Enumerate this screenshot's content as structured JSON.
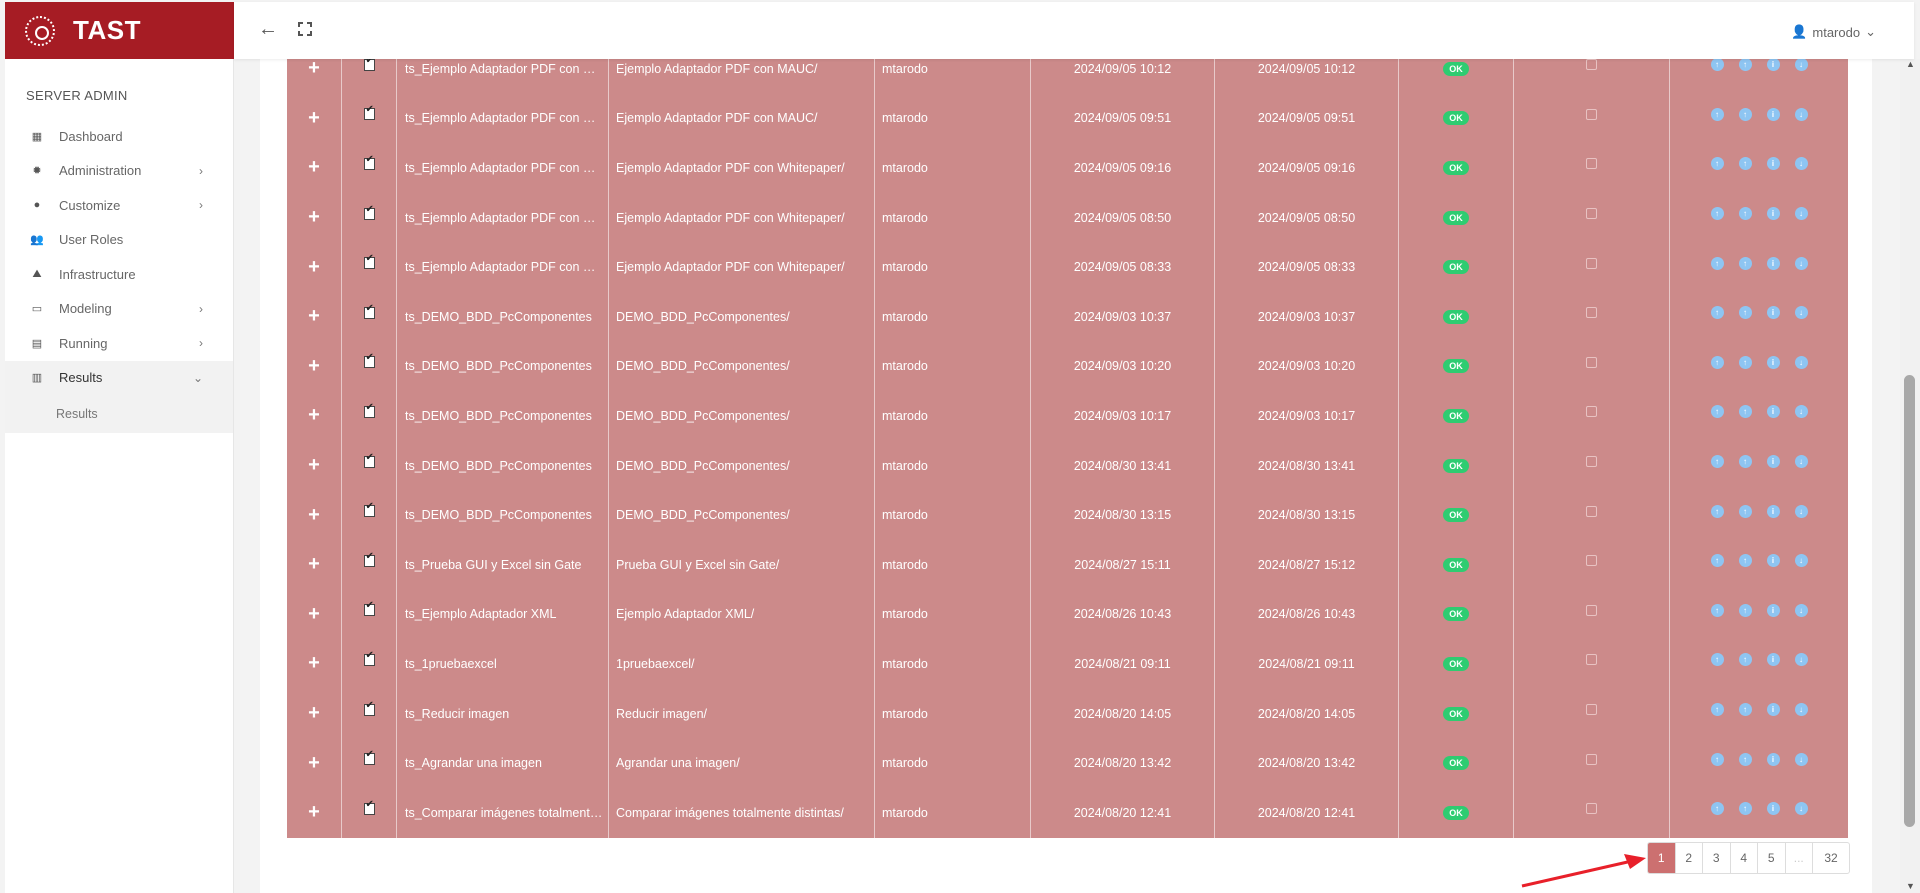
{
  "brand": {
    "name": "TAST"
  },
  "topbar": {
    "user": "mtarodo"
  },
  "sidebar": {
    "section": "SERVER ADMIN",
    "items": [
      {
        "label": "Dashboard",
        "icon": "dashboard-icon",
        "chevron": false
      },
      {
        "label": "Administration",
        "icon": "gear-icon",
        "chevron": true
      },
      {
        "label": "Customize",
        "icon": "palette-icon",
        "chevron": true
      },
      {
        "label": "User Roles",
        "icon": "users-icon",
        "chevron": false
      },
      {
        "label": "Infrastructure",
        "icon": "road-icon",
        "chevron": false
      },
      {
        "label": "Modeling",
        "icon": "database-icon",
        "chevron": true
      },
      {
        "label": "Running",
        "icon": "calendar-icon",
        "chevron": true
      },
      {
        "label": "Results",
        "icon": "bar-chart-icon",
        "chevron": true,
        "expanded": true
      }
    ],
    "subitem": "Results"
  },
  "rows": [
    {
      "name": "ts_Ejemplo Adaptador PDF con MAUC",
      "path": "Ejemplo Adaptador PDF con MAUC/",
      "user": "mtarodo",
      "start": "2024/09/05 10:12",
      "end": "2024/09/05 10:12",
      "status": "OK"
    },
    {
      "name": "ts_Ejemplo Adaptador PDF con MAUC",
      "path": "Ejemplo Adaptador PDF con MAUC/",
      "user": "mtarodo",
      "start": "2024/09/05 09:51",
      "end": "2024/09/05 09:51",
      "status": "OK"
    },
    {
      "name": "ts_Ejemplo Adaptador PDF con Whitepaper",
      "path": "Ejemplo Adaptador PDF con Whitepaper/",
      "user": "mtarodo",
      "start": "2024/09/05 09:16",
      "end": "2024/09/05 09:16",
      "status": "OK"
    },
    {
      "name": "ts_Ejemplo Adaptador PDF con Whitepaper",
      "path": "Ejemplo Adaptador PDF con Whitepaper/",
      "user": "mtarodo",
      "start": "2024/09/05 08:50",
      "end": "2024/09/05 08:50",
      "status": "OK"
    },
    {
      "name": "ts_Ejemplo Adaptador PDF con Whitepaper",
      "path": "Ejemplo Adaptador PDF con Whitepaper/",
      "user": "mtarodo",
      "start": "2024/09/05 08:33",
      "end": "2024/09/05 08:33",
      "status": "OK"
    },
    {
      "name": "ts_DEMO_BDD_PcComponentes",
      "path": "DEMO_BDD_PcComponentes/",
      "user": "mtarodo",
      "start": "2024/09/03 10:37",
      "end": "2024/09/03 10:37",
      "status": "OK"
    },
    {
      "name": "ts_DEMO_BDD_PcComponentes",
      "path": "DEMO_BDD_PcComponentes/",
      "user": "mtarodo",
      "start": "2024/09/03 10:20",
      "end": "2024/09/03 10:20",
      "status": "OK"
    },
    {
      "name": "ts_DEMO_BDD_PcComponentes",
      "path": "DEMO_BDD_PcComponentes/",
      "user": "mtarodo",
      "start": "2024/09/03 10:17",
      "end": "2024/09/03 10:17",
      "status": "OK"
    },
    {
      "name": "ts_DEMO_BDD_PcComponentes",
      "path": "DEMO_BDD_PcComponentes/",
      "user": "mtarodo",
      "start": "2024/08/30 13:41",
      "end": "2024/08/30 13:41",
      "status": "OK"
    },
    {
      "name": "ts_DEMO_BDD_PcComponentes",
      "path": "DEMO_BDD_PcComponentes/",
      "user": "mtarodo",
      "start": "2024/08/30 13:15",
      "end": "2024/08/30 13:15",
      "status": "OK"
    },
    {
      "name": "ts_Prueba GUI y Excel sin Gate",
      "path": "Prueba GUI y Excel sin Gate/",
      "user": "mtarodo",
      "start": "2024/08/27 15:11",
      "end": "2024/08/27 15:12",
      "status": "OK"
    },
    {
      "name": "ts_Ejemplo Adaptador XML",
      "path": "Ejemplo Adaptador XML/",
      "user": "mtarodo",
      "start": "2024/08/26 10:43",
      "end": "2024/08/26 10:43",
      "status": "OK"
    },
    {
      "name": "ts_1pruebaexcel",
      "path": "1pruebaexcel/",
      "user": "mtarodo",
      "start": "2024/08/21 09:11",
      "end": "2024/08/21 09:11",
      "status": "OK"
    },
    {
      "name": "ts_Reducir imagen",
      "path": "Reducir imagen/",
      "user": "mtarodo",
      "start": "2024/08/20 14:05",
      "end": "2024/08/20 14:05",
      "status": "OK"
    },
    {
      "name": "ts_Agrandar una imagen",
      "path": "Agrandar una imagen/",
      "user": "mtarodo",
      "start": "2024/08/20 13:42",
      "end": "2024/08/20 13:42",
      "status": "OK"
    },
    {
      "name": "ts_Comparar imágenes totalmente distintas",
      "path": "Comparar imágenes totalmente distintas/",
      "user": "mtarodo",
      "start": "2024/08/20 12:41",
      "end": "2024/08/20 12:41",
      "status": "OK"
    }
  ],
  "row_icons": {
    "expand": "+",
    "actions": [
      "upload-icon",
      "upload-icon",
      "info-icon",
      "download-icon"
    ]
  },
  "pagination": [
    "1",
    "2",
    "3",
    "4",
    "5",
    "...",
    "32"
  ],
  "colors": {
    "brand": "#a61c24",
    "row_bg": "#cc8a8a",
    "ok_badge": "#2ecc71",
    "action_icon": "#8ec5f2",
    "active_page": "#cc7070",
    "annotation_arrow": "#e8202a"
  }
}
